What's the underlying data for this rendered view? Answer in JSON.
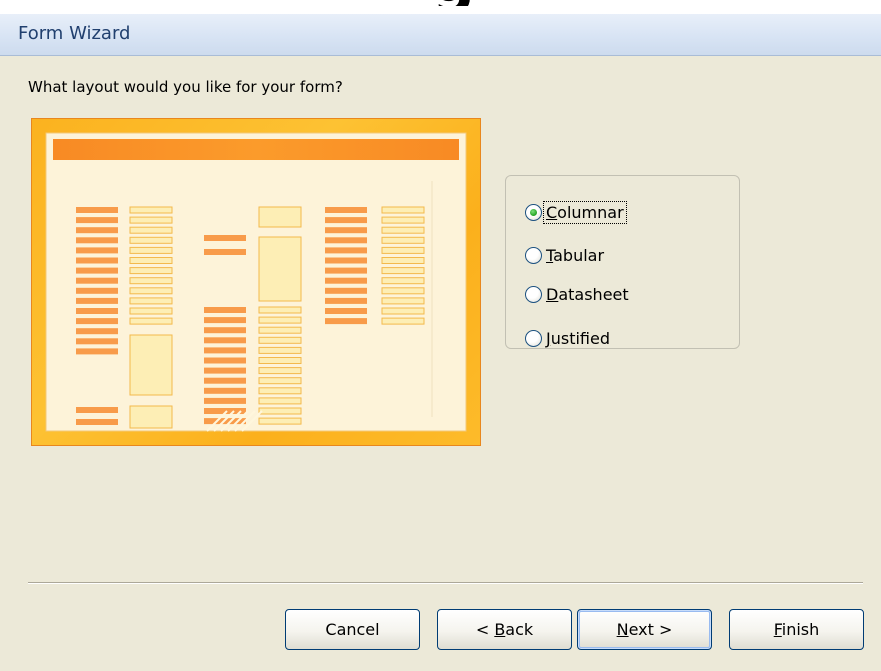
{
  "window": {
    "title": "Form Wizard"
  },
  "prompt": "What layout would you like for your form?",
  "layout_options": [
    {
      "label": "Columnar",
      "accel": "C",
      "rest": "olumnar",
      "selected": true
    },
    {
      "label": "Tabular",
      "accel": "T",
      "rest": "abular",
      "selected": false
    },
    {
      "label": "Datasheet",
      "accel": "D",
      "rest": "atasheet",
      "selected": false
    },
    {
      "label": "Justified",
      "accel": "J",
      "rest": "ustified",
      "selected": false
    }
  ],
  "buttons": {
    "cancel": {
      "label": "Cancel"
    },
    "back": {
      "pre": "< ",
      "accel": "B",
      "rest": "ack"
    },
    "next": {
      "pre": "",
      "accel": "N",
      "rest": "ext >"
    },
    "finish": {
      "pre": "",
      "accel": "F",
      "rest": "inish"
    }
  },
  "colors": {
    "title_text": "#21406f",
    "preview_orange": "#fbb21f",
    "preview_bar": "#f98f25",
    "radio_selected": "#21a121"
  }
}
